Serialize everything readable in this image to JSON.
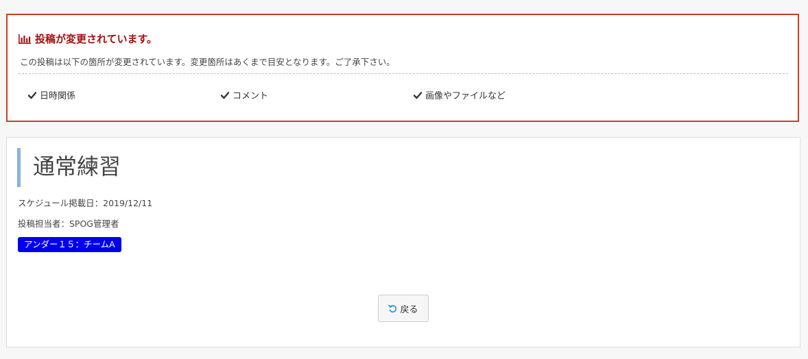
{
  "notice": {
    "icon": "bar-chart-icon",
    "title": "投稿が変更されています。",
    "description": "この投稿は以下の箇所が変更されています。変更箇所はあくまで目安となります。ご了承下さい。",
    "changes": [
      {
        "icon": "check-icon",
        "label": "日時関係"
      },
      {
        "icon": "check-icon",
        "label": "コメント"
      },
      {
        "icon": "check-icon",
        "label": "画像やファイルなど"
      }
    ],
    "colors": {
      "border": "#c9401c",
      "title": "#a60d0d"
    }
  },
  "post": {
    "title": "通常練習",
    "schedule_date": "スケジュール掲載日：2019/12/11",
    "author": "投稿担当者：SPOG管理者",
    "tag": "アンダー１５：チームA",
    "colors": {
      "tag_bg": "#0000ee",
      "title_bar": "#88b4d8"
    }
  },
  "actions": {
    "back_icon": "undo-icon",
    "back_label": "戻る"
  }
}
